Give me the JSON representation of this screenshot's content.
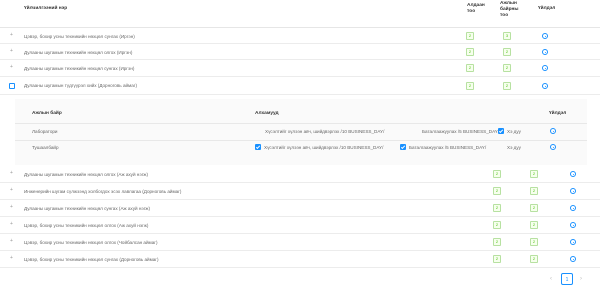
{
  "table": {
    "headers": {
      "name": "Үйлчилгээний нэр",
      "allowed": "Алдаан тоо",
      "workplaces": "Ажлын байрны тоо",
      "actions": "Үйлдэл"
    },
    "rows_top": [
      {
        "name": "Цэвэр, бохир усны техникийн нөхцөл сунгах (Иргэн)",
        "allowed": "2",
        "workplaces": "3"
      },
      {
        "name": "Дулааны шугамын техникийн нөхцөл олгох (Иргэн)",
        "allowed": "2",
        "workplaces": "2"
      },
      {
        "name": "Дулааны шугамын техникийн нөхцөл сунгах (Иргэн)",
        "allowed": "2",
        "workplaces": "2"
      },
      {
        "name": "Дулааны шугамын түдгүүрэл хийх (Дорноговь аймаг)",
        "allowed": "2",
        "workplaces": "2"
      }
    ],
    "rows_bottom": [
      {
        "name": "Дулааны шугамын техникийн нөхцөл олгох (Аж ахуй нэгж)",
        "allowed": "2",
        "workplaces": "2"
      },
      {
        "name": "Инженерийн шугам сүлжээнд холбогдох эсэх лавлагаа (Дорноговь аймаг)",
        "allowed": "2",
        "workplaces": "2"
      },
      {
        "name": "Дулааны шугамын техникийн нөхцөл сунгах (Аж ахуй нэгж)",
        "allowed": "2",
        "workplaces": "2"
      },
      {
        "name": "Цэвэр, бохир усны техникийн нөхцөл олгох (Аж ахуй нэгж)",
        "allowed": "2",
        "workplaces": "2"
      },
      {
        "name": "Цэвэр, бохир усны техникийн нөхцөл олгох (Чойбалсан аймаг)",
        "allowed": "2",
        "workplaces": "2"
      },
      {
        "name": "Цэвэр, бохир усны техникийн нөхцөл сунгах (Дорноговь аймаг)",
        "allowed": "2",
        "workplaces": "2"
      }
    ]
  },
  "nested": {
    "headers": {
      "workplace": "Ажлын байр",
      "steps": "Алхамууд",
      "actions": "Үйлдэл"
    },
    "rows": [
      {
        "workplace": "Лаборатори",
        "steps": [
          {
            "label": "Хүсэлтийг хүлээн авч, шийдвэрлэх /10 BUSINESS_DAY/",
            "checked": false
          },
          {
            "label": "Баталгаажуулах /5 BUSINESS_DAY/",
            "checked": false
          },
          {
            "label": "Хэ дуу",
            "checked": true
          }
        ]
      },
      {
        "workplace": "Тушаалбайр",
        "steps": [
          {
            "label": "Хүсэлтийг хүлээн авч, шийдвэрлэх /10 BUSINESS_DAY/",
            "checked": true
          },
          {
            "label": "Баталгаажуулах /5 BUSINESS_DAY/",
            "checked": true
          },
          {
            "label": "Хэ дуу",
            "checked": false
          }
        ]
      }
    ]
  },
  "pagination": {
    "prev": "‹",
    "current": "1",
    "next": "›"
  },
  "icons": {
    "expand": "plus-icon",
    "action": "settings-icon",
    "accent": "#1890ff",
    "badge": "#52c41a"
  }
}
